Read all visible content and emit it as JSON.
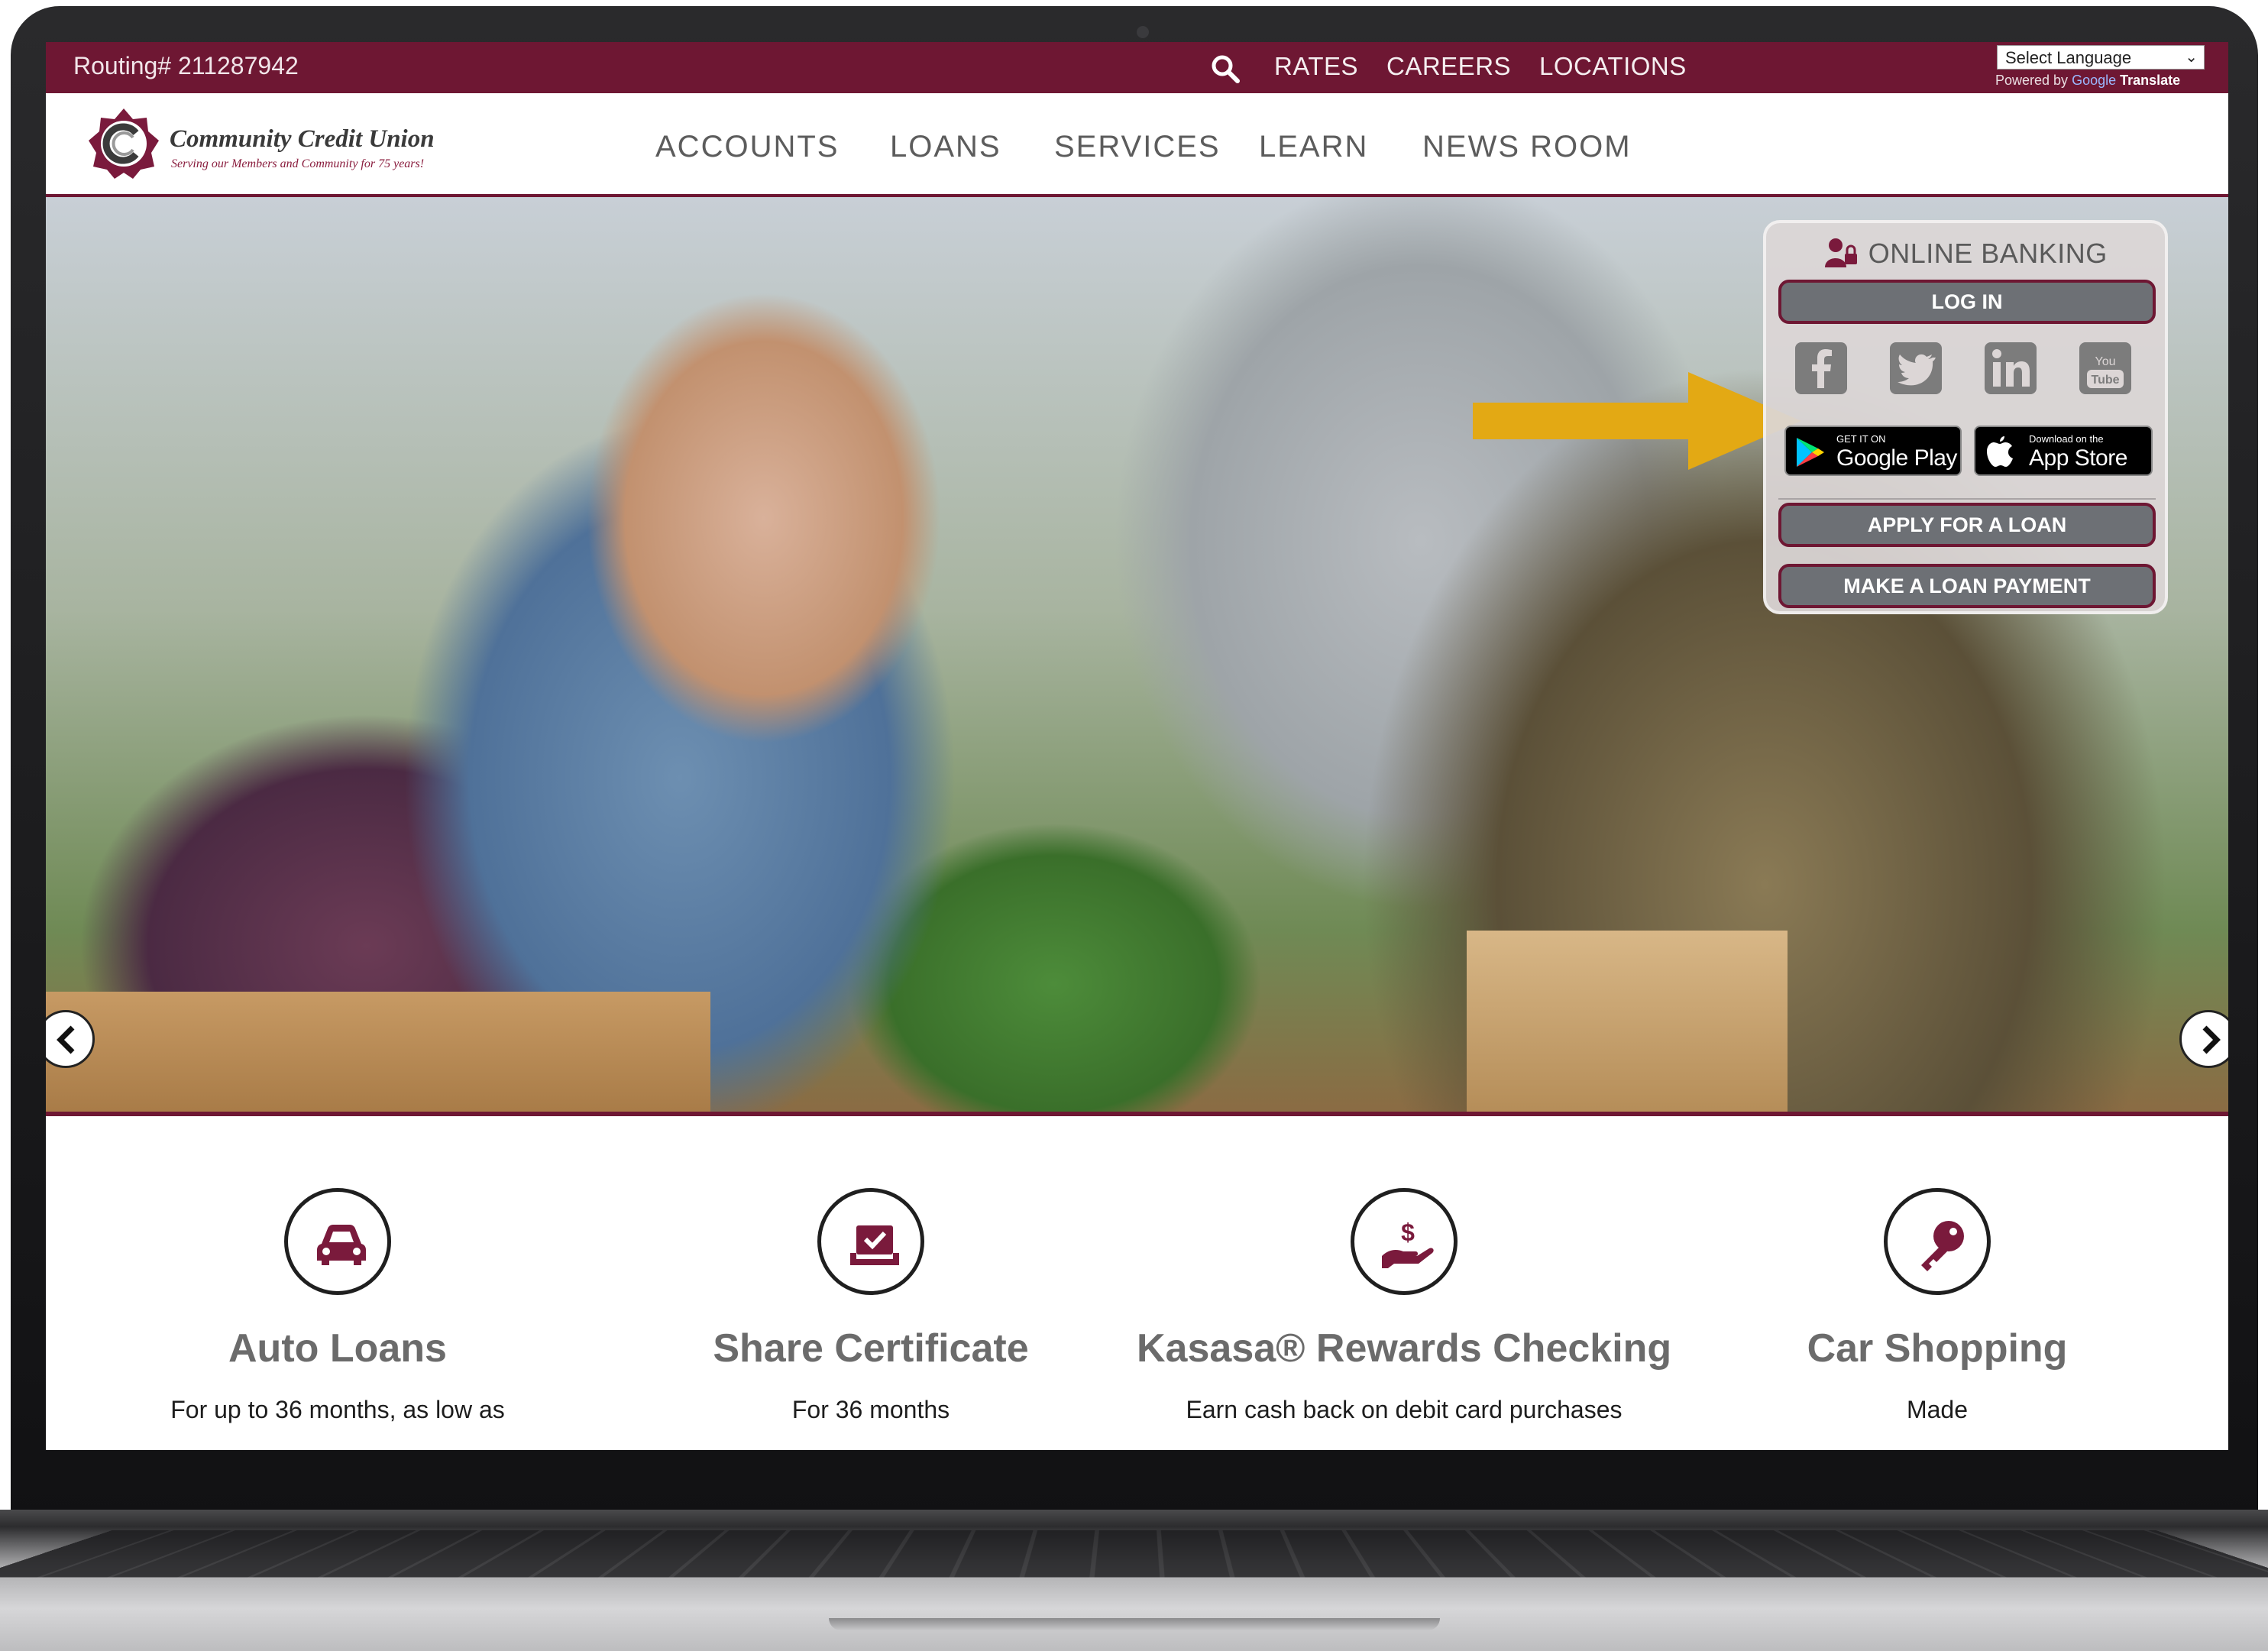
{
  "utility_bar": {
    "routing": "Routing# 211287942",
    "links": [
      "RATES",
      "CAREERS",
      "LOCATIONS"
    ],
    "language_select": "Select Language",
    "powered_by_prefix": "Powered by",
    "powered_by_google": "Google",
    "powered_by_suffix": "Translate"
  },
  "logo": {
    "name": "Community Credit Union",
    "tagline": "Serving our Members and Community for 75 years!"
  },
  "nav": {
    "items": [
      "ACCOUNTS",
      "LOANS",
      "SERVICES",
      "LEARN",
      "NEWS ROOM"
    ]
  },
  "online_banking": {
    "title": "ONLINE BANKING",
    "login": "LOG IN",
    "social": [
      "facebook",
      "twitter",
      "linkedin",
      "youtube"
    ],
    "google_play_small": "GET IT ON",
    "google_play_big": "Google Play",
    "app_store_small": "Download on the",
    "app_store_big": "App Store",
    "apply_loan": "APPLY FOR A LOAN",
    "loan_payment": "MAKE A LOAN PAYMENT"
  },
  "features": [
    {
      "icon": "car-icon",
      "title": "Auto Loans",
      "subtitle": "For up to 36 months, as low as"
    },
    {
      "icon": "certificate-icon",
      "title": "Share Certificate",
      "subtitle": "For 36 months"
    },
    {
      "icon": "cash-hand-icon",
      "title": "Kasasa® Rewards Checking",
      "subtitle": "Earn cash back on debit card purchases"
    },
    {
      "icon": "key-icon",
      "title": "Car Shopping",
      "subtitle": "Made"
    }
  ],
  "colors": {
    "brand_maroon": "#6e1733",
    "callout_arrow": "#e3a914",
    "button_gray": "#6d7075"
  }
}
